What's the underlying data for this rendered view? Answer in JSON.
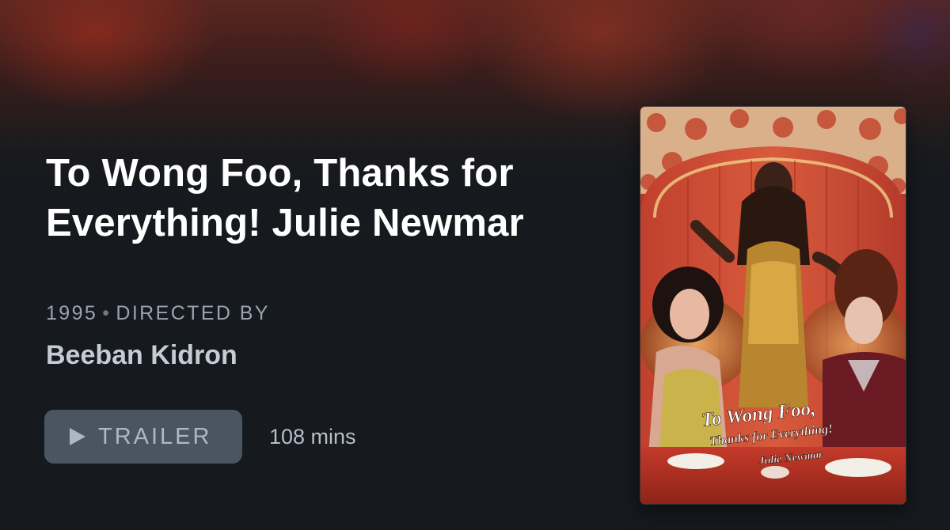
{
  "film": {
    "title": "To Wong Foo, Thanks for Everything! Julie Newmar",
    "year": "1995",
    "separator": "•",
    "directed_by_label": "DIRECTED BY",
    "director": "Beeban Kidron",
    "runtime": "108 mins"
  },
  "actions": {
    "trailer_label": "TRAILER",
    "trailer_icon": "play-icon"
  },
  "poster": {
    "title_line1": "To Wong Foo,",
    "title_line2": "Thanks for Everything!",
    "title_line3": "Julie Newmar"
  },
  "colors": {
    "background": "#16191d",
    "title": "#ffffff",
    "meta": "#9aa4b0",
    "button": "#4a5562",
    "button_text": "#aeb8c4"
  }
}
